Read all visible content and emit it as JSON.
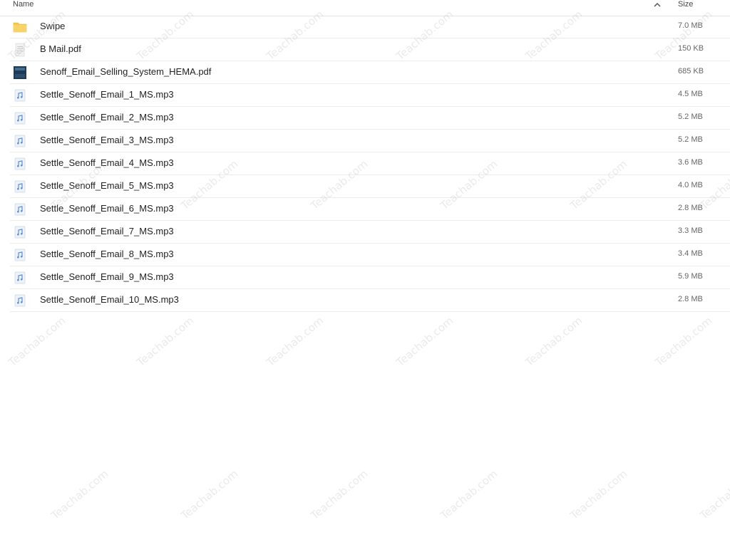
{
  "header": {
    "name_label": "Name",
    "size_label": "Size",
    "sort_icon": "chevron-up-icon"
  },
  "files": [
    {
      "name": "Swipe",
      "size": "7.0 MB",
      "type": "folder"
    },
    {
      "name": "B Mail.pdf",
      "size": "150 KB",
      "type": "pdf-generic"
    },
    {
      "name": "Senoff_Email_Selling_System_HEMA.pdf",
      "size": "685 KB",
      "type": "pdf-thumb"
    },
    {
      "name": "Settle_Senoff_Email_1_MS.mp3",
      "size": "4.5 MB",
      "type": "audio"
    },
    {
      "name": "Settle_Senoff_Email_2_MS.mp3",
      "size": "5.2 MB",
      "type": "audio"
    },
    {
      "name": "Settle_Senoff_Email_3_MS.mp3",
      "size": "5.2 MB",
      "type": "audio"
    },
    {
      "name": "Settle_Senoff_Email_4_MS.mp3",
      "size": "3.6 MB",
      "type": "audio"
    },
    {
      "name": "Settle_Senoff_Email_5_MS.mp3",
      "size": "4.0 MB",
      "type": "audio"
    },
    {
      "name": "Settle_Senoff_Email_6_MS.mp3",
      "size": "2.8 MB",
      "type": "audio"
    },
    {
      "name": "Settle_Senoff_Email_7_MS.mp3",
      "size": "3.3 MB",
      "type": "audio"
    },
    {
      "name": "Settle_Senoff_Email_8_MS.mp3",
      "size": "3.4 MB",
      "type": "audio"
    },
    {
      "name": "Settle_Senoff_Email_9_MS.mp3",
      "size": "5.9 MB",
      "type": "audio"
    },
    {
      "name": "Settle_Senoff_Email_10_MS.mp3",
      "size": "2.8 MB",
      "type": "audio"
    }
  ],
  "watermark_text": "Teachab.com",
  "colors": {
    "folder": "#f5c84c",
    "audio_icon": "#5b8ed6",
    "pdf_thumb": "#1f3a55"
  }
}
